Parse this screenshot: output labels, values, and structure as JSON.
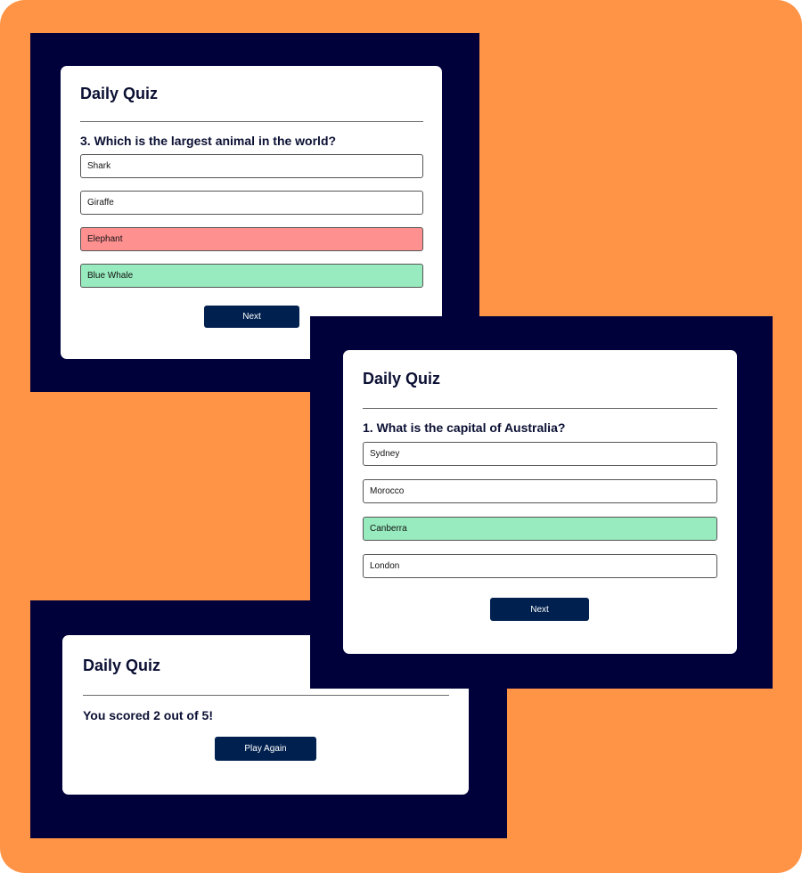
{
  "colors": {
    "background": "#FF9446",
    "frame": "#00013A",
    "button": "#00204F",
    "wrong": "#FF9090",
    "correct": "#98EBBE"
  },
  "card_a": {
    "title": "Daily Quiz",
    "question": "3. Which is the largest animal in the world?",
    "options": [
      {
        "label": "Shark",
        "state": "default"
      },
      {
        "label": "Giraffe",
        "state": "default"
      },
      {
        "label": "Elephant",
        "state": "wrong"
      },
      {
        "label": "Blue Whale",
        "state": "correct"
      }
    ],
    "next_label": "Next"
  },
  "card_b": {
    "title": "Daily Quiz",
    "question": "1. What is the capital of Australia?",
    "options": [
      {
        "label": "Sydney",
        "state": "default"
      },
      {
        "label": "Morocco",
        "state": "default"
      },
      {
        "label": "Canberra",
        "state": "correct"
      },
      {
        "label": "London",
        "state": "default"
      }
    ],
    "next_label": "Next"
  },
  "card_c": {
    "title": "Daily Quiz",
    "score_text": "You scored 2 out of 5!",
    "play_again_label": "Play Again"
  }
}
